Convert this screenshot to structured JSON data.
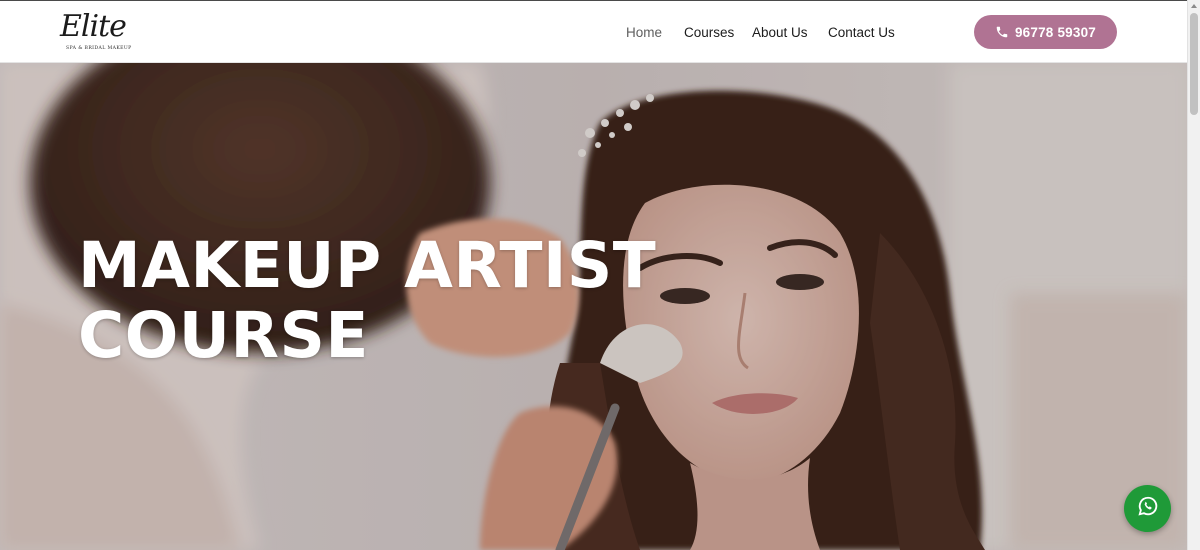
{
  "header": {
    "logo": {
      "text": "Elite",
      "subtitle": "SPA & BRIDAL MAKEUP"
    },
    "nav": [
      {
        "label": "Home",
        "active": true
      },
      {
        "label": "Courses",
        "active": false
      },
      {
        "label": "About Us",
        "active": false
      },
      {
        "label": "Contact Us",
        "active": false
      }
    ],
    "phone_button": {
      "label": "96778 59307",
      "icon": "phone-icon"
    }
  },
  "hero": {
    "title_line1": "MAKEUP ARTIST",
    "title_line2": "COURSE",
    "background": "photo of makeup artist applying brush to bride's face"
  },
  "floating": {
    "whatsapp_icon": "whatsapp-icon"
  },
  "colors": {
    "accent": "#b07393",
    "whatsapp": "#1f9a38",
    "nav_text": "#1c1c1c"
  }
}
